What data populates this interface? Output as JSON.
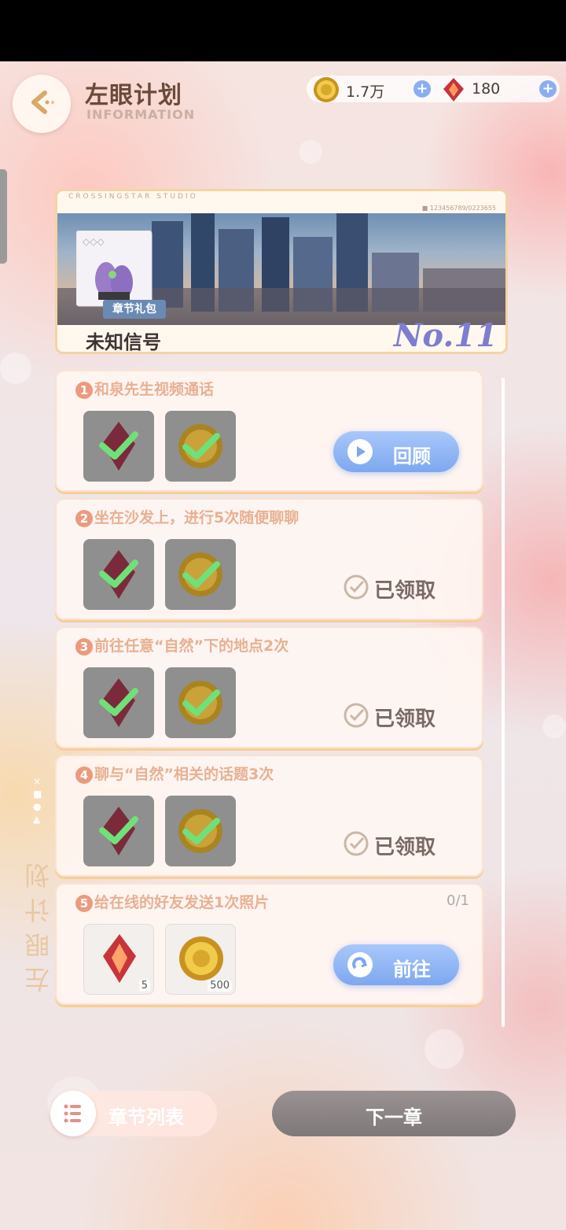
{
  "header": {
    "title": "左眼计划",
    "subtitle": "INFORMATION"
  },
  "currencies": [
    {
      "name": "gold-coin",
      "value": "1.7万",
      "color": "#d6a628"
    },
    {
      "name": "red-crystal",
      "value": "180",
      "color": "#d24a3a"
    }
  ],
  "chapter": {
    "studio": "CROSSINGSTAR STUDIO",
    "serial": "■ 123456789/0223655",
    "gift_label": "章节礼包",
    "name": "未知信号",
    "number": "No.11"
  },
  "tasks": [
    {
      "num": "1",
      "title": "和泉先生视频通话",
      "status": "review",
      "action_label": "回顾",
      "progress": "",
      "rewards": [
        {
          "icon": "red-crystal-icon",
          "claimed": true,
          "qty": ""
        },
        {
          "icon": "gold-coin-icon",
          "claimed": true,
          "qty": ""
        }
      ]
    },
    {
      "num": "2",
      "title": "坐在沙发上，进行5次随便聊聊",
      "status": "claimed",
      "action_label": "已领取",
      "progress": "",
      "rewards": [
        {
          "icon": "red-crystal-icon",
          "claimed": true,
          "qty": ""
        },
        {
          "icon": "gold-coin-icon",
          "claimed": true,
          "qty": ""
        }
      ]
    },
    {
      "num": "3",
      "title": "前往任意“自然”下的地点2次",
      "status": "claimed",
      "action_label": "已领取",
      "progress": "",
      "rewards": [
        {
          "icon": "red-crystal-icon",
          "claimed": true,
          "qty": ""
        },
        {
          "icon": "gold-coin-icon",
          "claimed": true,
          "qty": ""
        }
      ]
    },
    {
      "num": "4",
      "title": "聊与“自然”相关的话题3次",
      "status": "claimed",
      "action_label": "已领取",
      "progress": "",
      "rewards": [
        {
          "icon": "red-crystal-icon",
          "claimed": true,
          "qty": ""
        },
        {
          "icon": "gold-coin-icon",
          "claimed": true,
          "qty": ""
        }
      ]
    },
    {
      "num": "5",
      "title": "给在线的好友发送1次照片",
      "status": "go",
      "action_label": "前往",
      "progress": "0/1",
      "rewards": [
        {
          "icon": "red-crystal-icon",
          "claimed": false,
          "qty": "5"
        },
        {
          "icon": "gold-coin-icon",
          "claimed": false,
          "qty": "500"
        }
      ]
    }
  ],
  "sidebar_vertical_title": "左眼计划",
  "footer": {
    "chapter_list_label": "章节列表",
    "next_chapter_label": "下一章"
  }
}
